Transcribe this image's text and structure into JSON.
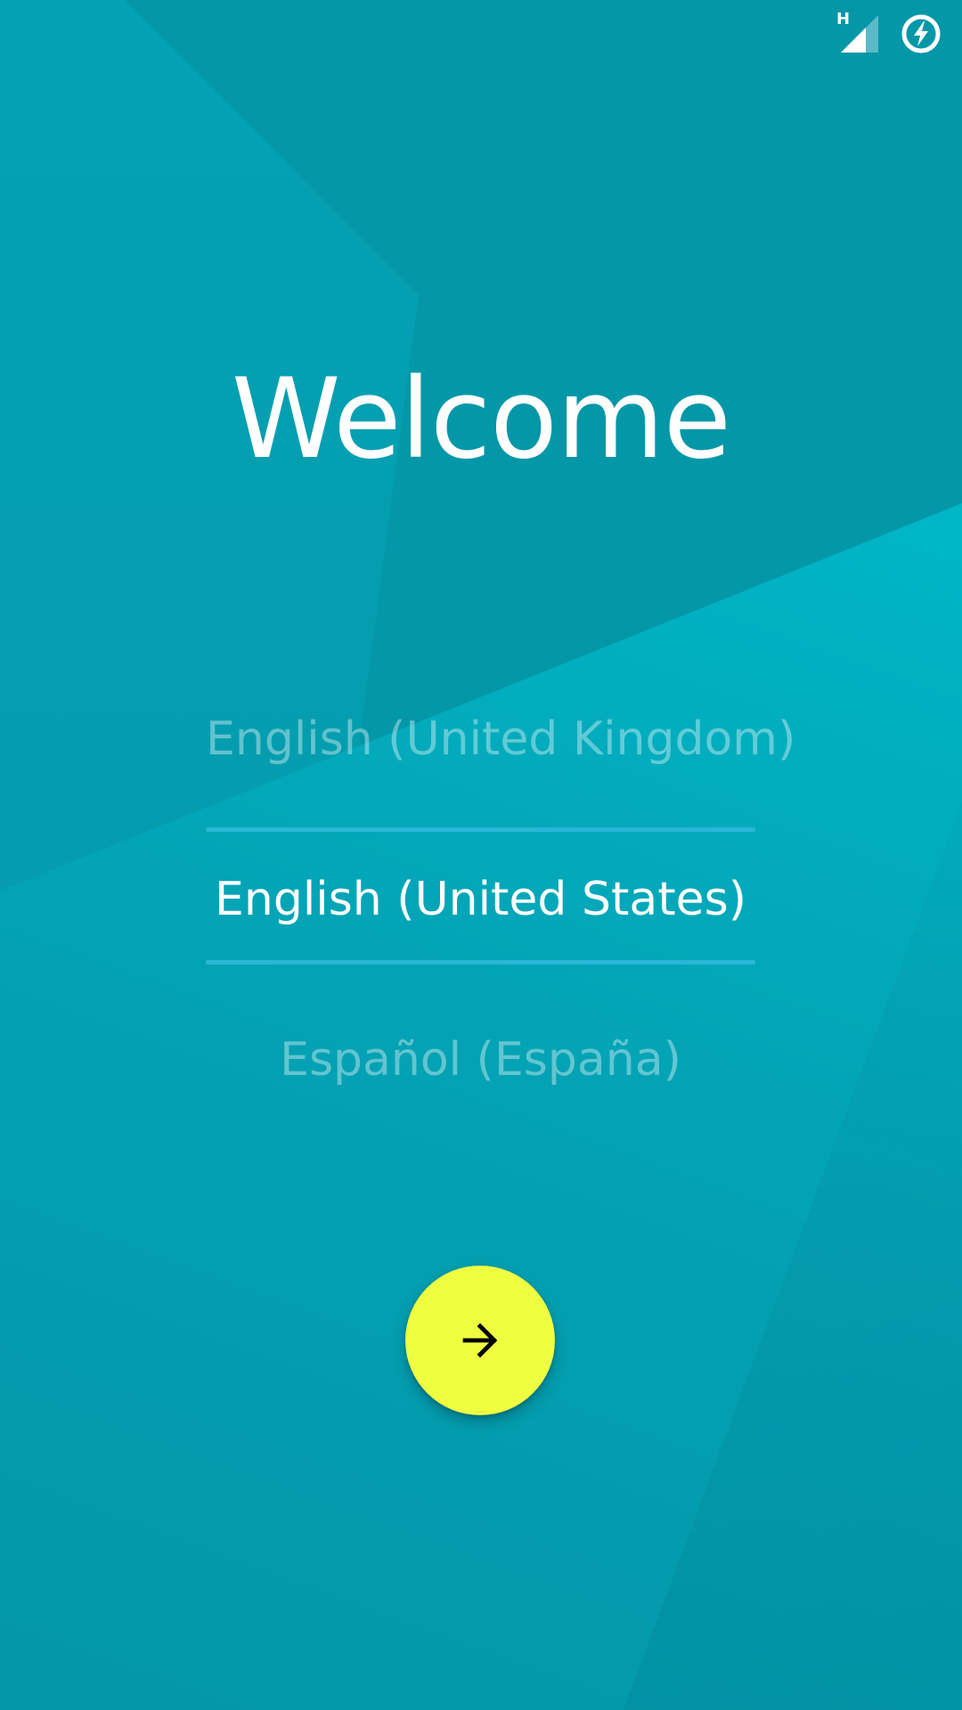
{
  "status_bar": {
    "network_type": "H",
    "icons": [
      "signal-icon",
      "battery-saver-icon"
    ]
  },
  "welcome": {
    "title": "Welcome"
  },
  "language_picker": {
    "items": [
      {
        "label": "English (United Kingdom)",
        "selected": false
      },
      {
        "label": "English (United States)",
        "selected": true
      },
      {
        "label": "Español (España)",
        "selected": false
      }
    ]
  },
  "next_button": {
    "icon": "arrow-forward-icon"
  },
  "colors": {
    "background": "#0397a8",
    "accent_light": "#00c7d5",
    "divider": "#29b7d6",
    "fab": "#eeff41"
  }
}
